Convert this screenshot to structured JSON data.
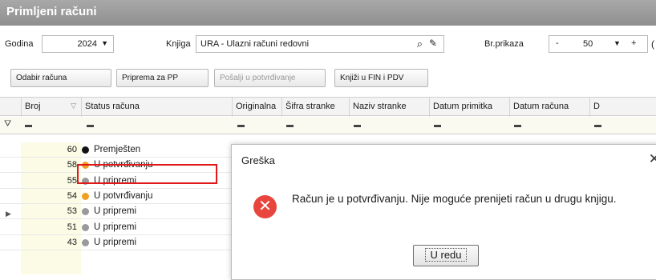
{
  "window": {
    "title": "Primljeni računi"
  },
  "filters": {
    "year_label": "Godina",
    "year_value": "2024",
    "book_label": "Knjiga",
    "book_value": "URA - Ulazni računi redovni",
    "count_label": "Br.prikaza",
    "count_minus": "-",
    "count_value": "50",
    "count_plus": "+",
    "count_extra": "("
  },
  "toolbar": {
    "select_invoice": "Odabir računa",
    "prepare_pp": "Priprema za PP",
    "send_confirm": "Pošalji u potvrđivanje",
    "post_fin_pdv": "Knjiži u FIN i PDV"
  },
  "grid": {
    "columns": [
      "Broj",
      "Status računa",
      "Originalna",
      "Šifra stranke",
      "Naziv stranke",
      "Datum primitka",
      "Datum računa",
      "D"
    ],
    "rows": [
      {
        "number": "60",
        "status": "Premješten",
        "color": "#111111"
      },
      {
        "number": "58",
        "status": "U potvrđivanju",
        "color": "#f0a020"
      },
      {
        "number": "55",
        "status": "U pripremi",
        "color": "#9a9a9a"
      },
      {
        "number": "54",
        "status": "U potvrđivanju",
        "color": "#f0a020"
      },
      {
        "number": "53",
        "status": "U pripremi",
        "color": "#9a9a9a"
      },
      {
        "number": "51",
        "status": "U pripremi",
        "color": "#9a9a9a"
      },
      {
        "number": "43",
        "status": "U pripremi",
        "color": "#9a9a9a"
      }
    ]
  },
  "dialog": {
    "title": "Greška",
    "message": "Račun je u potvrđivanju. Nije moguće prenijeti račun u drugu knjigu.",
    "ok_label": "U redu"
  }
}
